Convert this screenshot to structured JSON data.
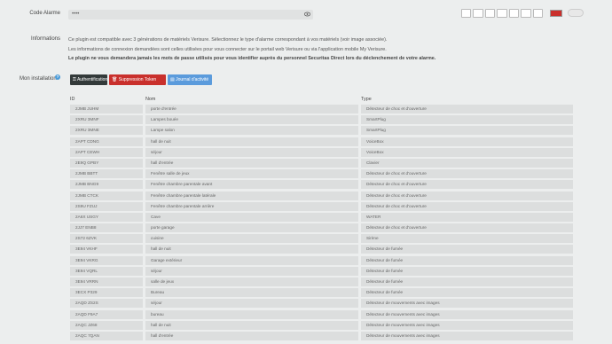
{
  "code_alarme": {
    "label": "Code Alarme",
    "value": "••••",
    "eye_icon": "eye-icon"
  },
  "informations": {
    "label": "Informations",
    "line1": "Ce plugin est compatible avec 3 générations de matériels Verisure. Sélectionnez le type d'alarme correspondant à vos matériels (voir image associée).",
    "line2": "Les informations de connexion demandées sont celles utilisées pour vous connecter sur le portail web Verisure ou via l'application mobile My Verisure.",
    "line3": "Le plugin ne vous demandera jamais les mots de passe utilisés pour vous identifier auprès du personnel Securitas Direct lors du déclenchement de votre alarme."
  },
  "installation": {
    "label": "Mon installation",
    "help_icon": "help-icon",
    "buttons": {
      "auth": "Authentification",
      "token": "Suppression Token",
      "journal": "Journal d'activité"
    }
  },
  "table": {
    "headers": {
      "id": "ID",
      "name": "Nom",
      "type": "Type"
    },
    "rows": [
      {
        "id": "2JMB JUHM",
        "name": "porte d'entrée",
        "type": "Détecteur de choc et d'ouverture"
      },
      {
        "id": "2XRU 3MNF",
        "name": "Lampes bouée",
        "type": "SmartPlug"
      },
      {
        "id": "2XRU 3MNE",
        "name": "Lampe salon",
        "type": "SmartPlug"
      },
      {
        "id": "2APT CDNG",
        "name": "hall de nuit",
        "type": "VoiceBox"
      },
      {
        "id": "2APT CEWH",
        "name": "séjour",
        "type": "VoiceBox"
      },
      {
        "id": "2E9Q GPBY",
        "name": "hall d'entrée",
        "type": "Clavier"
      },
      {
        "id": "2JMB BBTT",
        "name": "Fenêtre salle de jeux",
        "type": "Détecteur de choc et d'ouverture"
      },
      {
        "id": "2JMB BNG9",
        "name": "Fenêtre chambre parentale avant",
        "type": "Détecteur de choc et d'ouverture"
      },
      {
        "id": "2JMB CTCK",
        "name": "Fenêtre chambre parentale latérale",
        "type": "Détecteur de choc et d'ouverture"
      },
      {
        "id": "2S9U FZUJ",
        "name": "Fenêtre chambre parentale arrière",
        "type": "Détecteur de choc et d'ouverture"
      },
      {
        "id": "2A6X USGY",
        "name": "Cave",
        "type": "WATER"
      },
      {
        "id": "2JJ7 ENB8",
        "name": "porte garage",
        "type": "Détecteur de choc et d'ouverture"
      },
      {
        "id": "2S72 6ZVK",
        "name": "cuisine",
        "type": "Sirène"
      },
      {
        "id": "3E94 VKHF",
        "name": "hall de nuit",
        "type": "Détecteur de fumée"
      },
      {
        "id": "3E94 VKRG",
        "name": "Garage extérieur",
        "type": "Détecteur de fumée"
      },
      {
        "id": "3E94 VQRL",
        "name": "séjour",
        "type": "Détecteur de fumée"
      },
      {
        "id": "3E94 VRRN",
        "name": "salle de jeux",
        "type": "Détecteur de fumée"
      },
      {
        "id": "3ECX P329",
        "name": "Bureau",
        "type": "Détecteur de fumée"
      },
      {
        "id": "2AQD ZS2S",
        "name": "séjour",
        "type": "Détecteur de mouvements avec images"
      },
      {
        "id": "2AQD F9A7",
        "name": "bureau",
        "type": "Détecteur de mouvements avec images"
      },
      {
        "id": "2AQC JZ68",
        "name": "hall de nuit",
        "type": "Détecteur de mouvements avec images"
      },
      {
        "id": "2AQC 7QAN",
        "name": "hall d'entrée",
        "type": "Détecteur de mouvements avec images"
      }
    ]
  }
}
